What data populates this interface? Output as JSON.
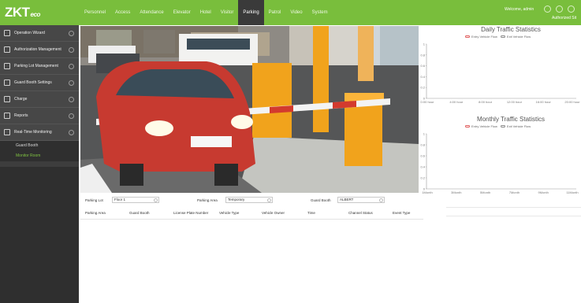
{
  "brand": {
    "logo_text": "ZKT",
    "logo_suffix": "eco"
  },
  "nav": {
    "items": [
      "Personnel",
      "Access",
      "Attendance",
      "Elevator",
      "Hotel",
      "Visitor",
      "Parking",
      "Patrol",
      "Video",
      "System"
    ],
    "active": "Parking"
  },
  "header": {
    "welcome": "Welcome, admin",
    "role": "Authorized Sit"
  },
  "sidebar": {
    "items": [
      {
        "label": "Operation Wizard",
        "icon": "wizard-icon"
      },
      {
        "label": "Authorization Management",
        "icon": "shield-icon"
      },
      {
        "label": "Parking Lot Management",
        "icon": "parking-icon"
      },
      {
        "label": "Guard Booth Settings",
        "icon": "booth-icon"
      },
      {
        "label": "Charge",
        "icon": "charge-icon"
      },
      {
        "label": "Reports",
        "icon": "report-icon"
      },
      {
        "label": "Real-Time Monitoring",
        "icon": "monitor-icon"
      }
    ],
    "subitems": [
      "Guard Booth",
      "Monitor Room"
    ]
  },
  "filters": {
    "parking_lot_label": "Parking Lot",
    "parking_lot_value": "Floor 1",
    "parking_area_label": "Parking Area",
    "parking_area_value": "Temporary",
    "guard_booth_label": "Guard Booth",
    "guard_booth_value": "ALBERT"
  },
  "table": {
    "headers": [
      "Parking Area",
      "Guard Booth",
      "License Plate Number",
      "Vehicle Type",
      "Vehicle Owner",
      "Time",
      "Channel Status",
      "Event Type"
    ]
  },
  "colors": {
    "topbar": "#79be3c",
    "sidebar": "#3d3d3d",
    "entry_series": "#e05b5b",
    "exit_series": "#8a8a8a"
  },
  "chart_data": [
    {
      "type": "line",
      "title": "Daily Traffic Statistics",
      "series": [
        {
          "name": "Entry Vehicle Flow",
          "values": []
        },
        {
          "name": "Exit Vehicle Flow",
          "values": []
        }
      ],
      "categories": [
        "0:00 hour",
        "4:00 hour",
        "8:00 hour",
        "12:00 hour",
        "16:00 hour",
        "20:00 hour"
      ],
      "yticks": [
        "0",
        "0.2",
        "0.4",
        "0.6",
        "0.8",
        "1"
      ],
      "ylim": [
        0,
        1
      ],
      "legend": "top"
    },
    {
      "type": "line",
      "title": "Monthly Traffic Statistics",
      "series": [
        {
          "name": "Entry Vehicle Flow",
          "values": []
        },
        {
          "name": "Exit Vehicle Flow",
          "values": []
        }
      ],
      "categories": [
        "1Month",
        "3Month",
        "5Month",
        "7Month",
        "9Month",
        "11Month"
      ],
      "yticks": [
        "0",
        "0.2",
        "0.4",
        "0.6",
        "0.8",
        "1"
      ],
      "ylim": [
        0,
        1
      ],
      "legend": "top"
    }
  ]
}
